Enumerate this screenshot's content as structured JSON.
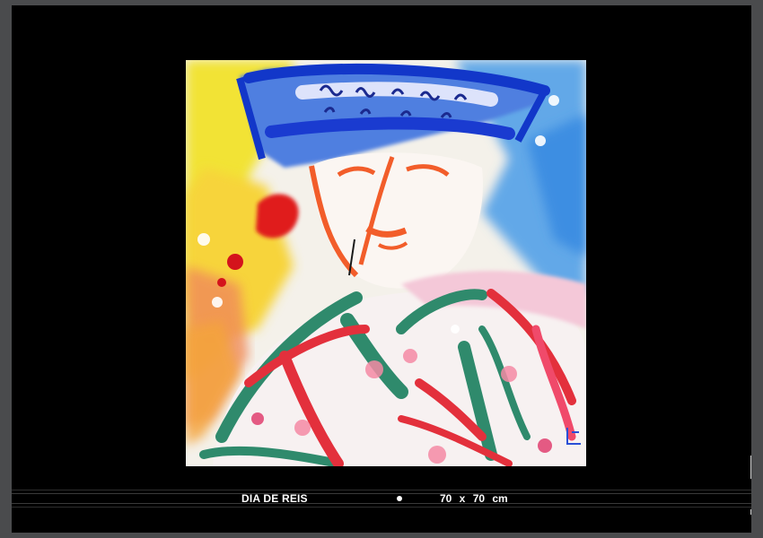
{
  "artwork": {
    "title": "DIA DE REIS",
    "dimensions": "70 x 70 cm"
  },
  "colors": {
    "page_background": "#4a4b4d",
    "frame_background": "#000000",
    "caption_text": "#ffffff"
  }
}
